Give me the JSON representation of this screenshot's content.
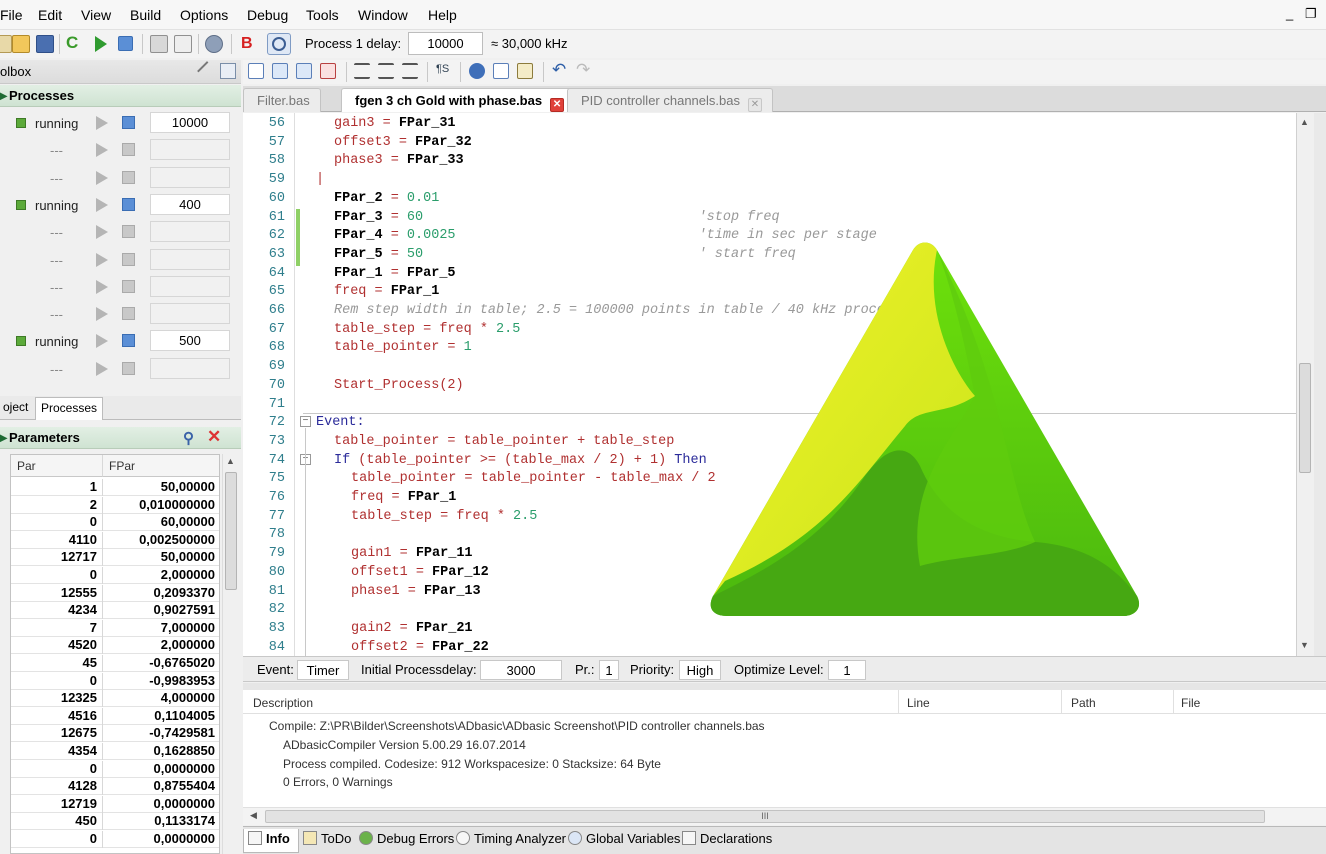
{
  "menu": {
    "items": [
      "File",
      "Edit",
      "View",
      "Build",
      "Options",
      "Debug",
      "Tools",
      "Window",
      "Help"
    ],
    "minimize": "_",
    "restore": "❐"
  },
  "toolbar": {
    "process_delay_label": "Process 1 delay:",
    "process_delay_value": "10000",
    "frequency": "≈ 30,000 kHz",
    "b_label": "B"
  },
  "toolbox": {
    "title": "olbox",
    "processes_title": "Processes",
    "processes": [
      {
        "status": "running",
        "delay": "10000"
      },
      {
        "status": "---",
        "delay": ""
      },
      {
        "status": "---",
        "delay": ""
      },
      {
        "status": "running",
        "delay": "400"
      },
      {
        "status": "---",
        "delay": ""
      },
      {
        "status": "---",
        "delay": ""
      },
      {
        "status": "---",
        "delay": ""
      },
      {
        "status": "---",
        "delay": ""
      },
      {
        "status": "running",
        "delay": "500"
      },
      {
        "status": "---",
        "delay": ""
      }
    ],
    "tabs": [
      "oject",
      "Processes"
    ],
    "parameters_title": "Parameters",
    "param_columns": [
      "Par",
      "FPar"
    ],
    "params": [
      {
        "par": "1",
        "fpar": "50,00000"
      },
      {
        "par": "2",
        "fpar": "0,010000000"
      },
      {
        "par": "0",
        "fpar": "60,00000"
      },
      {
        "par": "4110",
        "fpar": "0,002500000"
      },
      {
        "par": "12717",
        "fpar": "50,00000"
      },
      {
        "par": "0",
        "fpar": "2,000000"
      },
      {
        "par": "12555",
        "fpar": "0,2093370"
      },
      {
        "par": "4234",
        "fpar": "0,9027591"
      },
      {
        "par": "7",
        "fpar": "7,000000"
      },
      {
        "par": "4520",
        "fpar": "2,000000"
      },
      {
        "par": "45",
        "fpar": "-0,6765020"
      },
      {
        "par": "0",
        "fpar": "-0,9983953"
      },
      {
        "par": "12325",
        "fpar": "4,000000"
      },
      {
        "par": "4516",
        "fpar": "0,1104005"
      },
      {
        "par": "12675",
        "fpar": "-0,7429581"
      },
      {
        "par": "4354",
        "fpar": "0,1628850"
      },
      {
        "par": "0",
        "fpar": "0,0000000"
      },
      {
        "par": "4128",
        "fpar": "0,8755404"
      },
      {
        "par": "12719",
        "fpar": "0,0000000"
      },
      {
        "par": "450",
        "fpar": "0,1133174"
      },
      {
        "par": "0",
        "fpar": "0,0000000"
      }
    ]
  },
  "editor": {
    "tabs": [
      "Filter.bas",
      "fgen 3 ch Gold with phase.bas",
      "PID controller channels.bas"
    ],
    "active_tab": "fgen 3 ch Gold with phase.bas",
    "lines": [
      {
        "n": "56",
        "indent": 1,
        "parts": [
          [
            "v",
            "gain3"
          ],
          [
            "o",
            " = "
          ],
          [
            "f",
            "FPar_31"
          ]
        ]
      },
      {
        "n": "57",
        "indent": 1,
        "parts": [
          [
            "v",
            "offset3"
          ],
          [
            "o",
            " = "
          ],
          [
            "f",
            "FPar_32"
          ]
        ]
      },
      {
        "n": "58",
        "indent": 1,
        "parts": [
          [
            "v",
            "phase3"
          ],
          [
            "o",
            " = "
          ],
          [
            "f",
            "FPar_33"
          ]
        ]
      },
      {
        "n": "59",
        "indent": 0,
        "parts": [
          [
            "o",
            "|"
          ]
        ]
      },
      {
        "n": "60",
        "indent": 1,
        "parts": [
          [
            "f",
            "FPar_2"
          ],
          [
            "o",
            " = "
          ],
          [
            "n",
            "0.01"
          ]
        ]
      },
      {
        "n": "61",
        "indent": 1,
        "parts": [
          [
            "f",
            "FPar_3"
          ],
          [
            "o",
            " = "
          ],
          [
            "n",
            "60"
          ],
          [
            "c",
            "                                  'stop freq"
          ]
        ]
      },
      {
        "n": "62",
        "indent": 1,
        "parts": [
          [
            "f",
            "FPar_4"
          ],
          [
            "o",
            " = "
          ],
          [
            "n",
            "0.0025"
          ],
          [
            "c",
            "                              'time in sec per stage"
          ]
        ]
      },
      {
        "n": "63",
        "indent": 1,
        "parts": [
          [
            "f",
            "FPar_5"
          ],
          [
            "o",
            " = "
          ],
          [
            "n",
            "50"
          ],
          [
            "c",
            "                                  ' start freq"
          ]
        ]
      },
      {
        "n": "64",
        "indent": 1,
        "parts": [
          [
            "f",
            "FPar_1"
          ],
          [
            "o",
            " = "
          ],
          [
            "f",
            "FPar_5"
          ]
        ]
      },
      {
        "n": "65",
        "indent": 1,
        "parts": [
          [
            "v",
            "freq"
          ],
          [
            "o",
            " = "
          ],
          [
            "f",
            "FPar_1"
          ]
        ]
      },
      {
        "n": "66",
        "indent": 1,
        "parts": [
          [
            "c",
            "Rem step width in table; 2.5 = 100000 points in table / 40 kHz process delay"
          ]
        ]
      },
      {
        "n": "67",
        "indent": 1,
        "parts": [
          [
            "v",
            "table_step"
          ],
          [
            "o",
            " = "
          ],
          [
            "v",
            "freq"
          ],
          [
            "o",
            " * "
          ],
          [
            "n",
            "2.5"
          ]
        ]
      },
      {
        "n": "68",
        "indent": 1,
        "parts": [
          [
            "v",
            "table_pointer"
          ],
          [
            "o",
            " = "
          ],
          [
            "n",
            "1"
          ]
        ]
      },
      {
        "n": "69",
        "indent": 0,
        "parts": []
      },
      {
        "n": "70",
        "indent": 1,
        "parts": [
          [
            "v",
            "Start_Process"
          ],
          [
            "o",
            "(2)"
          ]
        ]
      },
      {
        "n": "71",
        "indent": 0,
        "parts": []
      },
      {
        "n": "72",
        "indent": 0,
        "parts": [
          [
            "k",
            "Event:"
          ]
        ]
      },
      {
        "n": "73",
        "indent": 1,
        "parts": [
          [
            "v",
            "table_pointer"
          ],
          [
            "o",
            " = "
          ],
          [
            "v",
            "table_pointer"
          ],
          [
            "o",
            " + "
          ],
          [
            "v",
            "table_step"
          ]
        ]
      },
      {
        "n": "74",
        "indent": 1,
        "parts": [
          [
            "k",
            "If"
          ],
          [
            "o",
            " ("
          ],
          [
            "v",
            "table_pointer"
          ],
          [
            "o",
            " >= ("
          ],
          [
            "v",
            "table_max"
          ],
          [
            "o",
            " / 2) + 1) "
          ],
          [
            "k",
            "Then"
          ]
        ]
      },
      {
        "n": "75",
        "indent": 2,
        "parts": [
          [
            "v",
            "table_pointer"
          ],
          [
            "o",
            " = "
          ],
          [
            "v",
            "table_pointer"
          ],
          [
            "o",
            " - "
          ],
          [
            "v",
            "table_max"
          ],
          [
            "o",
            " / 2"
          ]
        ]
      },
      {
        "n": "76",
        "indent": 2,
        "parts": [
          [
            "v",
            "freq"
          ],
          [
            "o",
            " = "
          ],
          [
            "f",
            "FPar_1"
          ]
        ]
      },
      {
        "n": "77",
        "indent": 2,
        "parts": [
          [
            "v",
            "table_step"
          ],
          [
            "o",
            " = "
          ],
          [
            "v",
            "freq"
          ],
          [
            "o",
            " * "
          ],
          [
            "n",
            "2.5"
          ]
        ]
      },
      {
        "n": "78",
        "indent": 0,
        "parts": []
      },
      {
        "n": "79",
        "indent": 2,
        "parts": [
          [
            "v",
            "gain1"
          ],
          [
            "o",
            " = "
          ],
          [
            "f",
            "FPar_11"
          ]
        ]
      },
      {
        "n": "80",
        "indent": 2,
        "parts": [
          [
            "v",
            "offset1"
          ],
          [
            "o",
            " = "
          ],
          [
            "f",
            "FPar_12"
          ]
        ]
      },
      {
        "n": "81",
        "indent": 2,
        "parts": [
          [
            "v",
            "phase1"
          ],
          [
            "o",
            " = "
          ],
          [
            "f",
            "FPar_13"
          ]
        ]
      },
      {
        "n": "82",
        "indent": 0,
        "parts": []
      },
      {
        "n": "83",
        "indent": 2,
        "parts": [
          [
            "v",
            "gain2"
          ],
          [
            "o",
            " = "
          ],
          [
            "f",
            "FPar_21"
          ]
        ]
      },
      {
        "n": "84",
        "indent": 2,
        "parts": [
          [
            "v",
            "offset2"
          ],
          [
            "o",
            " = "
          ],
          [
            "f",
            "FPar_22"
          ]
        ]
      }
    ]
  },
  "statusbar": {
    "event_label": "Event:",
    "event_value": "Timer",
    "initial_label": "Initial Processdelay:",
    "initial_value": "3000",
    "pr_label": "Pr.:",
    "pr_value": "1",
    "priority_label": "Priority:",
    "priority_value": "High",
    "optimize_label": "Optimize Level:",
    "optimize_value": "1"
  },
  "output": {
    "columns": [
      "Description",
      "Line",
      "Path",
      "File"
    ],
    "lines": [
      "Compile: Z:\\PR\\Bilder\\Screenshots\\ADbasic\\ADbasic Screenshot\\PID controller channels.bas",
      "ADbasicCompiler Version 5.00.29 16.07.2014",
      "Process compiled. Codesize: 912 Workspacesize: 0 Stacksize: 64 Byte",
      "0 Errors, 0 Warnings"
    ],
    "scroll_grip": "III"
  },
  "bottom_tabs": [
    "Info",
    "ToDo",
    "Debug Errors",
    "Timing Analyzer",
    "Global Variables",
    "Declarations"
  ],
  "colors": {
    "logo_yellow": "#ecef1e",
    "logo_green_light": "#62d20a",
    "logo_green_dark": "#3d9c10",
    "accent_green": "#5caa3a"
  }
}
